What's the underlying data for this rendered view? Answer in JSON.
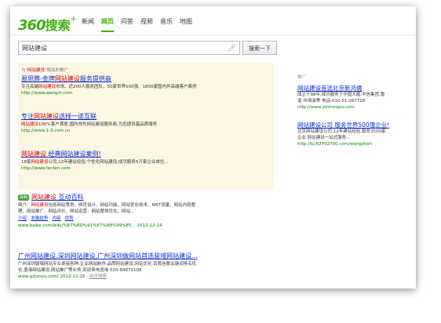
{
  "logo": {
    "num": "360",
    "text": "搜索",
    "plus": "+"
  },
  "nav": [
    {
      "label": "新闻",
      "active": false
    },
    {
      "label": "网页",
      "active": true
    },
    {
      "label": "问答",
      "active": false
    },
    {
      "label": "视频",
      "active": false
    },
    {
      "label": "音乐",
      "active": false
    },
    {
      "label": "地图",
      "active": false
    }
  ],
  "search": {
    "value": "网站建设",
    "button": "搜索一下"
  },
  "ads_header": {
    "pre": "与\"",
    "kw": "网站建设",
    "post": "\"相关的推广"
  },
  "ads": [
    {
      "title_a": "易思腾-金牌",
      "title_hl": "网站建设",
      "title_b": "服务提供商",
      "desc_a": "专注高端",
      "desc_hl": "网站建设",
      "desc_b": "市场，近200人服务团队，50家世界500强、1800家国内外高端客户案例",
      "url": "http://www.wangzt.com"
    },
    {
      "title_a": "专注",
      "title_hl": "网站建设",
      "title_b": "选择一诺互联",
      "desc_a": "",
      "desc_hl": "网站建设",
      "desc_b": "100%客户满意,国内领先网站建设服务商,为您提供基品质服务",
      "url": "http://www.1-3.com.cn"
    },
    {
      "title_a": "",
      "title_hl": "网站建设",
      "title_b": " 经典网站建设案例!",
      "desc_a": "18家",
      "desc_hl": "网站建设",
      "desc_b": "公司,12年建站经验;个性化网站建设,成功服务5万家企业单位...",
      "url": "http://www.fenfen.com"
    }
  ],
  "result1": {
    "tag": "百科",
    "title_hl": "网站建设",
    "title_b": " 互动百科",
    "desc1_a": "简介：",
    "desc1_hl": "网站建设",
    "desc1_b": "包括网站策划、网页设计、网站功能、网站优化技术、NNT流量、网站内容整",
    "desc2": "理、网站推广、网站评价、网站运营、网站整体优化、网站...",
    "links": [
      "介绍",
      "发展趋势",
      "内容",
      "优势"
    ],
    "url": "www.baike.com/wiki/%E7%BD%91%E7%AB%99%E5... 2012-12-14"
  },
  "result2": {
    "title": "广州网站建设,深圳网站建设,广州深圳做网站首选骏域网站建设...",
    "desc1": "广州深圳骏域网站专业承接各种:企业网站制作,品牌网站建设,网站优化,百度谷歌关键词排名优",
    "desc2": "化,香港网站建设,网站推广等业务,欢迎来电咨询 020-84872108",
    "url": "www.gzjunyu.com/ 2012-12-18 - ",
    "snapshot": "网页快照"
  },
  "right": {
    "header": "推广",
    "ads": [
      {
        "title": "网站建设首选北京新鸿儒",
        "desc1": "成立于98年,成功服务于中国大唐,中信集团,雷",
        "desc2": "诺,中海油等 电话:010-51 267718",
        "url": "http://www.xinhongru.com"
      },
      {
        "title": "网站建设公司 服务世界500强企业!",
        "desc1": "北京网站建设公司,12年建站经验,服务3500家",
        "desc2": "企业,网站建设一站式服务...",
        "url": "http://bj.62702700.com/wangzhan"
      }
    ]
  },
  "colors": {
    "brand": "#3eaf0e",
    "link": "#0b2ed0",
    "url": "#008000",
    "highlight": "#cc0000",
    "ad_bg": "#fdf6e5"
  }
}
